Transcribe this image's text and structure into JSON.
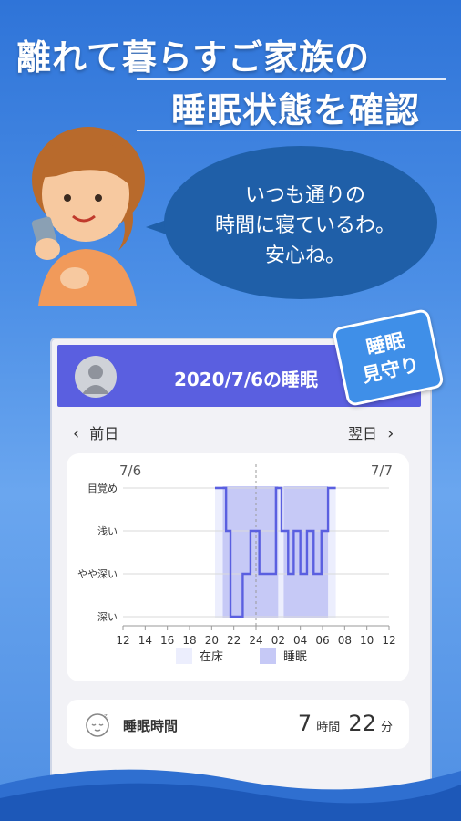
{
  "headline": {
    "line1": "離れて暮らすご家族の",
    "line2": "睡眠状態を確認"
  },
  "bubble": {
    "line1": "いつも通りの",
    "line2": "時間に寝ているわ。",
    "line3": "安心ね。"
  },
  "badge": {
    "line1": "睡眠",
    "line2": "見守り"
  },
  "app": {
    "title": "2020/7/6の睡眠",
    "nav_prev": "前日",
    "nav_next": "翌日",
    "sleep_label": "睡眠時間",
    "sleep_hours": "7",
    "hours_unit": "時間",
    "sleep_minutes": "22",
    "minutes_unit": "分"
  },
  "chart_data": {
    "type": "line",
    "date_left": "7/6",
    "date_right": "7/7",
    "x_ticks": [
      "12",
      "14",
      "16",
      "18",
      "20",
      "22",
      "24",
      "02",
      "04",
      "06",
      "08",
      "10",
      "12"
    ],
    "y_levels": [
      "目覚め",
      "浅い",
      "やや深い",
      "深い"
    ],
    "legend": [
      "在床",
      "睡眠"
    ],
    "in_bed": [
      [
        20.3,
        31.2
      ]
    ],
    "sleep": [
      [
        21.0,
        26.0
      ],
      [
        26.5,
        30.5
      ]
    ],
    "depth": [
      [
        20.3,
        0
      ],
      [
        21.3,
        0
      ],
      [
        21.3,
        1
      ],
      [
        21.7,
        1
      ],
      [
        21.7,
        3
      ],
      [
        22.8,
        3
      ],
      [
        22.8,
        2
      ],
      [
        23.5,
        2
      ],
      [
        23.5,
        1
      ],
      [
        24.3,
        1
      ],
      [
        24.3,
        2
      ],
      [
        25.8,
        2
      ],
      [
        25.8,
        0
      ],
      [
        26.3,
        0
      ],
      [
        26.3,
        1
      ],
      [
        26.9,
        1
      ],
      [
        26.9,
        2
      ],
      [
        27.4,
        2
      ],
      [
        27.4,
        1
      ],
      [
        28.0,
        1
      ],
      [
        28.0,
        2
      ],
      [
        28.6,
        2
      ],
      [
        28.6,
        1
      ],
      [
        29.2,
        1
      ],
      [
        29.2,
        2
      ],
      [
        29.9,
        2
      ],
      [
        29.9,
        1
      ],
      [
        30.5,
        1
      ],
      [
        30.5,
        0
      ],
      [
        31.2,
        0
      ]
    ],
    "colors": {
      "in_bed": "#eceefd",
      "sleep": "#c6c9f6",
      "line": "#5a5fe0"
    }
  }
}
